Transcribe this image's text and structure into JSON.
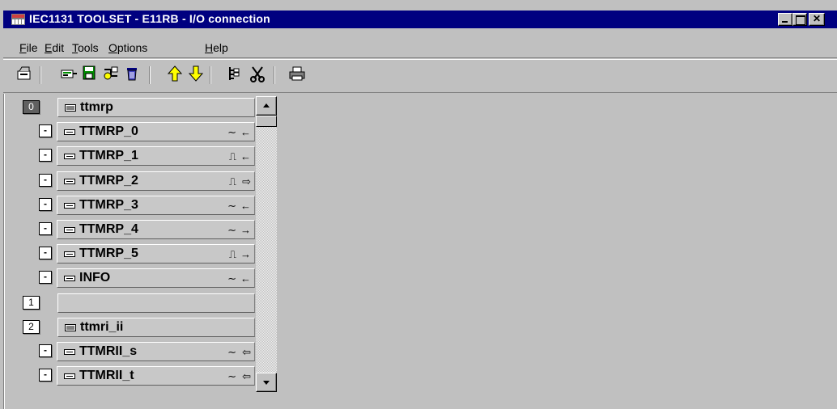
{
  "window": {
    "title": "IEC1131 TOOLSET - E11RB - I/O connection",
    "icon": "iec-toolset-app-icon",
    "controls": [
      "minimize",
      "maximize",
      "close"
    ]
  },
  "menu": {
    "items": [
      {
        "label": "File",
        "u": "F",
        "rest": "ile"
      },
      {
        "label": "Edit",
        "u": "E",
        "rest": "dit"
      },
      {
        "label": "Tools",
        "u": "T",
        "rest": "ools"
      },
      {
        "label": "Options",
        "u": "O",
        "rest": "ptions"
      },
      {
        "label": "Help",
        "u": "H",
        "rest": "elp"
      }
    ]
  },
  "toolbar": {
    "buttons": [
      "open-icon",
      "connect-icon",
      "disk-io-icon",
      "link-icon",
      "delete-icon",
      "move-up-icon",
      "move-down-icon",
      "tree-icon",
      "cut-icon",
      "print-icon"
    ]
  },
  "tree": {
    "rows": [
      {
        "index": "0",
        "kind": "module",
        "label": "ttmrp",
        "signal": "",
        "dir": ""
      },
      {
        "index": "-",
        "kind": "channel",
        "label": "TTMRP_0",
        "signal": "∼",
        "dir": "←"
      },
      {
        "index": "-",
        "kind": "channel",
        "label": "TTMRP_1",
        "signal": "⎍",
        "dir": "←"
      },
      {
        "index": "-",
        "kind": "channel",
        "label": "TTMRP_2",
        "signal": "⎍",
        "dir": "⇨"
      },
      {
        "index": "-",
        "kind": "channel",
        "label": "TTMRP_3",
        "signal": "∼",
        "dir": "←"
      },
      {
        "index": "-",
        "kind": "channel",
        "label": "TTMRP_4",
        "signal": "∼",
        "dir": "→"
      },
      {
        "index": "-",
        "kind": "channel",
        "label": "TTMRP_5",
        "signal": "⎍",
        "dir": "→"
      },
      {
        "index": "-",
        "kind": "channel",
        "label": "INFO",
        "signal": "∼",
        "dir": "←"
      },
      {
        "index": "1",
        "kind": "empty",
        "label": "",
        "signal": "",
        "dir": ""
      },
      {
        "index": "2",
        "kind": "module",
        "label": "ttmri_ii",
        "signal": "",
        "dir": ""
      },
      {
        "index": "-",
        "kind": "channel",
        "label": "TTMRII_s",
        "signal": "∼",
        "dir": "⇦"
      },
      {
        "index": "-",
        "kind": "channel",
        "label": "TTMRII_t",
        "signal": "∼",
        "dir": "⇦"
      }
    ]
  },
  "colors": {
    "title_bar": "#000080",
    "face": "#c0c0c0",
    "selected_index": "#606060"
  }
}
